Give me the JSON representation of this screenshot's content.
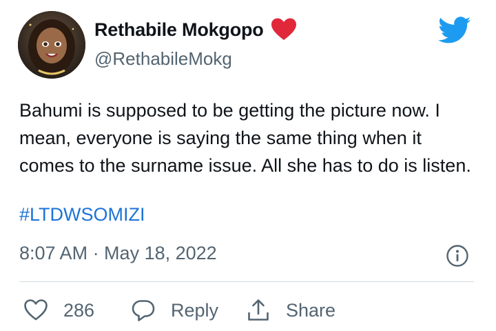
{
  "author": {
    "display_name": "Rethabile Mokgopo",
    "handle": "@RethabileMokg",
    "badge_icon": "red-heart-icon",
    "badge_color": "#e0283a"
  },
  "brand": {
    "logo_icon": "twitter-bird-icon",
    "color": "#1d9bf0"
  },
  "tweet": {
    "text": "Bahumi is supposed to be getting the picture now. I mean, everyone is saying the same thing when it comes to the surname issue. All she has to do is listen.",
    "hashtag": "#LTDWSOMIZI",
    "hashtag_color": "#1d73d8",
    "timestamp": "8:07 AM · May 18, 2022"
  },
  "actions": {
    "like_count": "286",
    "reply_label": "Reply",
    "share_label": "Share"
  }
}
